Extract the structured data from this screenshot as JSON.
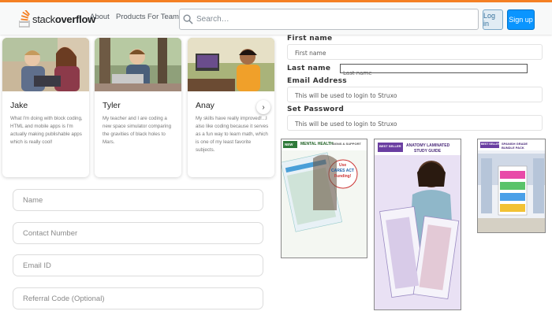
{
  "header": {
    "logo_prefix": "stack",
    "logo_suffix": "overflow",
    "nav": [
      "About",
      "Products",
      "For Teams"
    ],
    "search_placeholder": "Search…",
    "login_label": "Log in",
    "signup_label": "Sign up",
    "accent_color": "#f48024",
    "primary_color": "#0a95ff"
  },
  "students": [
    {
      "name": "Jake",
      "quote": "What I'm doing with block coding, HTML and mobile apps is I'm actually making publishable apps which is really cool!"
    },
    {
      "name": "Tyler",
      "quote": "My teacher and I are coding a new space simulator comparing the gravities of black holes to Mars."
    },
    {
      "name": "Anay",
      "quote": "My skills have really improved!...I also like coding because it serves as a fun way to learn math, which is one of my least favorite subjects."
    }
  ],
  "contact_form": {
    "placeholders": [
      "Name",
      "Contact Number",
      "Email ID",
      "Referral Code (Optional)"
    ]
  },
  "registration_form": {
    "first_name_label": "First name",
    "first_name_placeholder": "First name",
    "last_name_label": "Last name",
    "last_name_placeholder": "Last name",
    "email_label": "Email Address",
    "email_placeholder": "This will be used to login to Struxo",
    "password_label": "Set Password",
    "password_placeholder": "This will be used to login to Struxo"
  },
  "products": {
    "p1": {
      "tag": "NEW",
      "title": "MENTAL HEALTH",
      "subtitle": "SIGNS & SUPPORT",
      "badge_line1": "Use",
      "badge_line2": "CARES ACT",
      "badge_line3": "Funding!"
    },
    "p2": {
      "tag": "BEST SELLER",
      "title": "ANATOMY LAMINATED",
      "title2": "STUDY GUIDE"
    },
    "p3": {
      "tag": "BEST SELLER",
      "title": "SPANISH GRADE",
      "title2": "BUNDLE PACK"
    }
  }
}
